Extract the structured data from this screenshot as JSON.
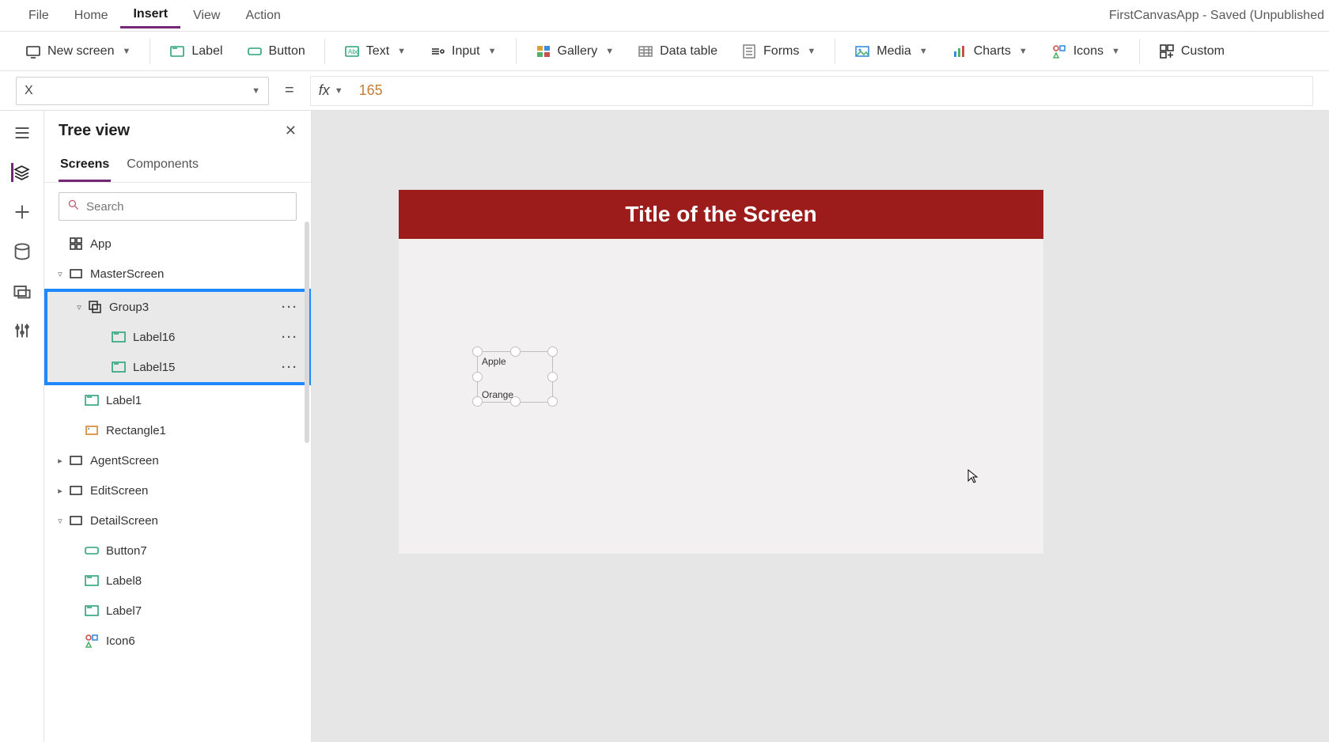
{
  "app_title": "FirstCanvasApp - Saved (Unpublished",
  "menu": {
    "file": "File",
    "home": "Home",
    "insert": "Insert",
    "view": "View",
    "action": "Action",
    "active": "insert"
  },
  "ribbon": {
    "newscreen": "New screen",
    "label": "Label",
    "button": "Button",
    "text": "Text",
    "input": "Input",
    "gallery": "Gallery",
    "datatable": "Data table",
    "forms": "Forms",
    "media": "Media",
    "charts": "Charts",
    "icons": "Icons",
    "custom": "Custom"
  },
  "formula": {
    "property": "X",
    "fx": "fx",
    "value": "165"
  },
  "tree": {
    "title": "Tree view",
    "tabs": {
      "screens": "Screens",
      "components": "Components",
      "active": "screens"
    },
    "search_placeholder": "Search",
    "app": "App",
    "masterscreen": "MasterScreen",
    "group3": "Group3",
    "label16": "Label16",
    "label15": "Label15",
    "label1": "Label1",
    "rectangle1": "Rectangle1",
    "agentscreen": "AgentScreen",
    "editscreen": "EditScreen",
    "detailscreen": "DetailScreen",
    "button7": "Button7",
    "label8": "Label8",
    "label7": "Label7",
    "icon6": "Icon6"
  },
  "canvas": {
    "screen_title": "Title of the Screen",
    "label_a": "Apple",
    "label_b": "Orange"
  }
}
